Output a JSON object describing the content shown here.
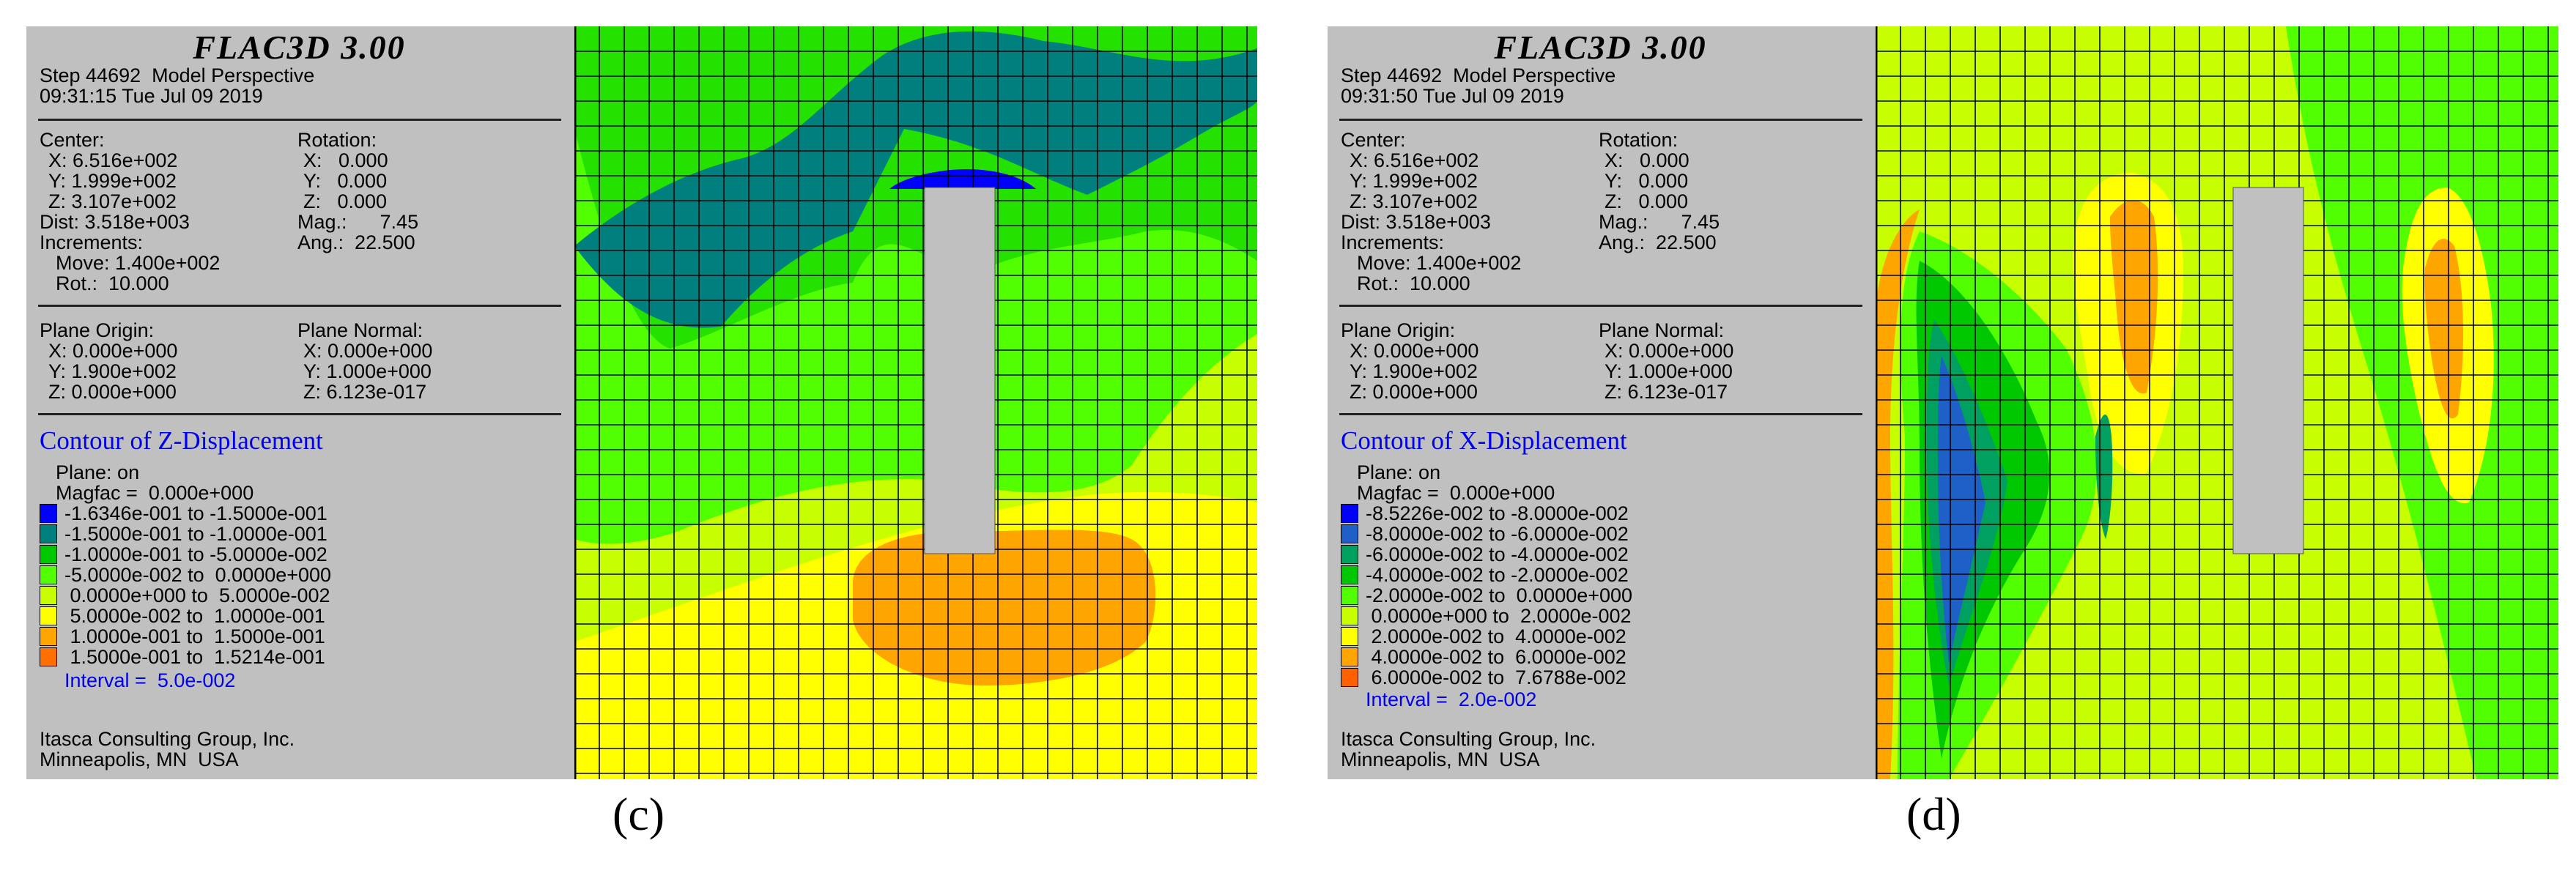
{
  "figures": [
    {
      "id": "c",
      "caption": "(c)",
      "header": {
        "title": "FLAC3D 3.00",
        "step_line": "Step 44692  Model Perspective",
        "time_line": "09:31:15 Tue Jul 09 2019"
      },
      "view": {
        "center_label": "Center:",
        "center_x": "X: 6.516e+002",
        "center_y": "Y: 1.999e+002",
        "center_z": "Z: 3.107e+002",
        "dist": "Dist: 3.518e+003",
        "increments": "Increments:",
        "move": "Move: 1.400e+002",
        "rot": "Rot.:  10.000",
        "rotation_label": "Rotation:",
        "rot_x": "X:   0.000",
        "rot_y": "Y:   0.000",
        "rot_z": "Z:   0.000",
        "mag": "Mag.:      7.45",
        "ang": "Ang.:  22.500"
      },
      "plane": {
        "origin_label": "Plane Origin:",
        "origin_x": "X: 0.000e+000",
        "origin_y": "Y: 1.900e+002",
        "origin_z": "Z: 0.000e+000",
        "normal_label": "Plane Normal:",
        "normal_x": "X: 0.000e+000",
        "normal_y": "Y: 1.000e+000",
        "normal_z": "Z: 6.123e-017"
      },
      "contour": {
        "title": "Contour of Z-Displacement",
        "plane_on": "Plane: on",
        "magfac": "Magfac =  0.000e+000",
        "interval": "Interval =  5.0e-002",
        "legend": [
          {
            "label": "-1.6346e-001 to -1.5000e-001",
            "color": "#0000ff"
          },
          {
            "label": "-1.5000e-001 to -1.0000e-001",
            "color": "#007f7f"
          },
          {
            "label": "-1.0000e-001 to -5.0000e-002",
            "color": "#00c800"
          },
          {
            "label": "-5.0000e-002 to  0.0000e+000",
            "color": "#52ff00"
          },
          {
            "label": " 0.0000e+000 to  5.0000e-002",
            "color": "#c8ff00"
          },
          {
            "label": " 5.0000e-002 to  1.0000e-001",
            "color": "#ffff00"
          },
          {
            "label": " 1.0000e-001 to  1.5000e-001",
            "color": "#ffa500"
          },
          {
            "label": " 1.5000e-001 to  1.5214e-001",
            "color": "#ff7000"
          }
        ]
      },
      "footer": {
        "company": "Itasca Consulting Group, Inc.",
        "location": "Minneapolis, MN  USA"
      }
    },
    {
      "id": "d",
      "caption": "(d)",
      "header": {
        "title": "FLAC3D 3.00",
        "step_line": "Step 44692  Model Perspective",
        "time_line": "09:31:50 Tue Jul 09 2019"
      },
      "view": {
        "center_label": "Center:",
        "center_x": "X: 6.516e+002",
        "center_y": "Y: 1.999e+002",
        "center_z": "Z: 3.107e+002",
        "dist": "Dist: 3.518e+003",
        "increments": "Increments:",
        "move": "Move: 1.400e+002",
        "rot": "Rot.:  10.000",
        "rotation_label": "Rotation:",
        "rot_x": "X:   0.000",
        "rot_y": "Y:   0.000",
        "rot_z": "Z:   0.000",
        "mag": "Mag.:      7.45",
        "ang": "Ang.:  22.500"
      },
      "plane": {
        "origin_label": "Plane Origin:",
        "origin_x": "X: 0.000e+000",
        "origin_y": "Y: 1.900e+002",
        "origin_z": "Z: 0.000e+000",
        "normal_label": "Plane Normal:",
        "normal_x": "X: 0.000e+000",
        "normal_y": "Y: 1.000e+000",
        "normal_z": "Z: 6.123e-017"
      },
      "contour": {
        "title": "Contour of X-Displacement",
        "plane_on": "Plane: on",
        "magfac": "Magfac =  0.000e+000",
        "interval": "Interval =  2.0e-002",
        "legend": [
          {
            "label": "-8.5226e-002 to -8.0000e-002",
            "color": "#0000ff"
          },
          {
            "label": "-8.0000e-002 to -6.0000e-002",
            "color": "#1f5fc8"
          },
          {
            "label": "-6.0000e-002 to -4.0000e-002",
            "color": "#00a060"
          },
          {
            "label": "-4.0000e-002 to -2.0000e-002",
            "color": "#00c800"
          },
          {
            "label": "-2.0000e-002 to  0.0000e+000",
            "color": "#52ff00"
          },
          {
            "label": " 0.0000e+000 to  2.0000e-002",
            "color": "#c8ff00"
          },
          {
            "label": " 2.0000e-002 to  4.0000e-002",
            "color": "#ffff00"
          },
          {
            "label": " 4.0000e-002 to  6.0000e-002",
            "color": "#ffa500"
          },
          {
            "label": " 6.0000e-002 to  7.6788e-002",
            "color": "#ff6000"
          }
        ]
      },
      "footer": {
        "company": "Itasca Consulting Group, Inc.",
        "location": "Minneapolis, MN  USA"
      }
    }
  ]
}
